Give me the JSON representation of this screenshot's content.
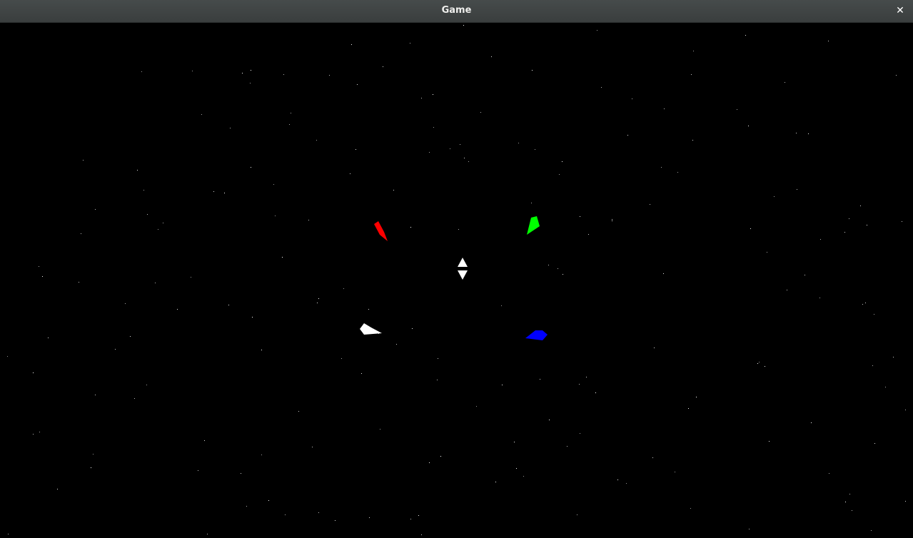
{
  "window": {
    "title": "Game",
    "close_glyph": "✕"
  },
  "scene": {
    "background_color": "#000000",
    "star_color": "#ffffff",
    "ships": [
      {
        "name": "red-ship",
        "color": "#ff0000"
      },
      {
        "name": "green-ship",
        "color": "#00ff00"
      },
      {
        "name": "white-ship",
        "color": "#ffffff"
      },
      {
        "name": "blue-ship",
        "color": "#0000ff"
      }
    ],
    "center_marker": {
      "color": "#ffffff",
      "icon": "up-down-arrows-icon"
    }
  }
}
